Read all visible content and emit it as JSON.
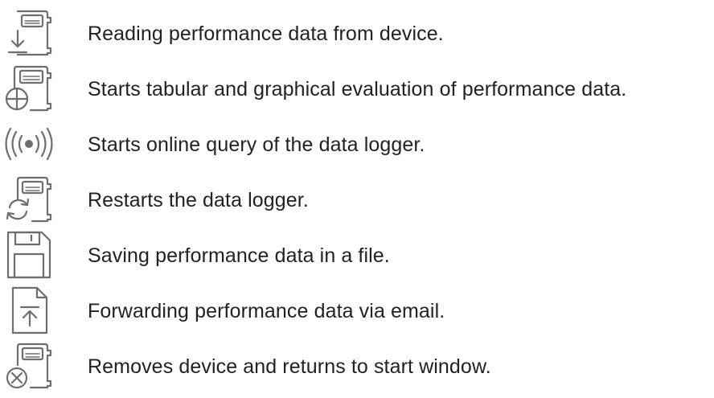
{
  "legend": {
    "items": [
      {
        "icon": "read-device-icon",
        "text": "Reading performance data from device."
      },
      {
        "icon": "evaluation-chart-icon",
        "text": "Starts tabular and graphical evaluation of performance data."
      },
      {
        "icon": "online-query-icon",
        "text": "Starts online query of the data logger."
      },
      {
        "icon": "restart-logger-icon",
        "text": "Restarts the data logger."
      },
      {
        "icon": "save-file-icon",
        "text": "Saving performance data in a file."
      },
      {
        "icon": "email-forward-icon",
        "text": "Forwarding performance data via email."
      },
      {
        "icon": "remove-device-icon",
        "text": "Removes device and returns to start window."
      }
    ]
  },
  "colors": {
    "icon_stroke": "#6e6e6e",
    "text": "#222222",
    "background": "#ffffff"
  }
}
